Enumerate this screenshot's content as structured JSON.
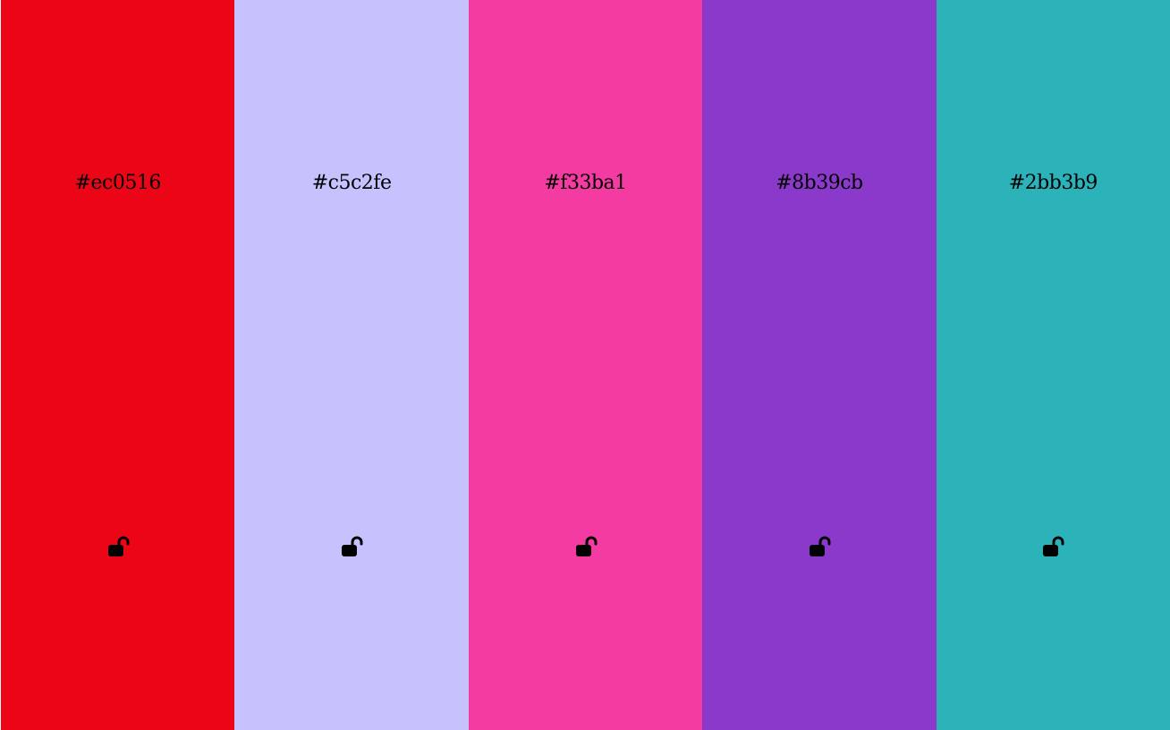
{
  "palette": {
    "swatches": [
      {
        "hex_label": "#ec0516",
        "color": "#ec0516",
        "lock_icon": "unlocked-padlock-icon"
      },
      {
        "hex_label": "#c5c2fe",
        "color": "#c5c2fe",
        "lock_icon": "unlocked-padlock-icon"
      },
      {
        "hex_label": "#f33ba1",
        "color": "#f33ba1",
        "lock_icon": "unlocked-padlock-icon"
      },
      {
        "hex_label": "#8b39cb",
        "color": "#8b39cb",
        "lock_icon": "unlocked-padlock-icon"
      },
      {
        "hex_label": "#2bb3b9",
        "color": "#2bb3b9",
        "lock_icon": "unlocked-padlock-icon"
      }
    ]
  }
}
